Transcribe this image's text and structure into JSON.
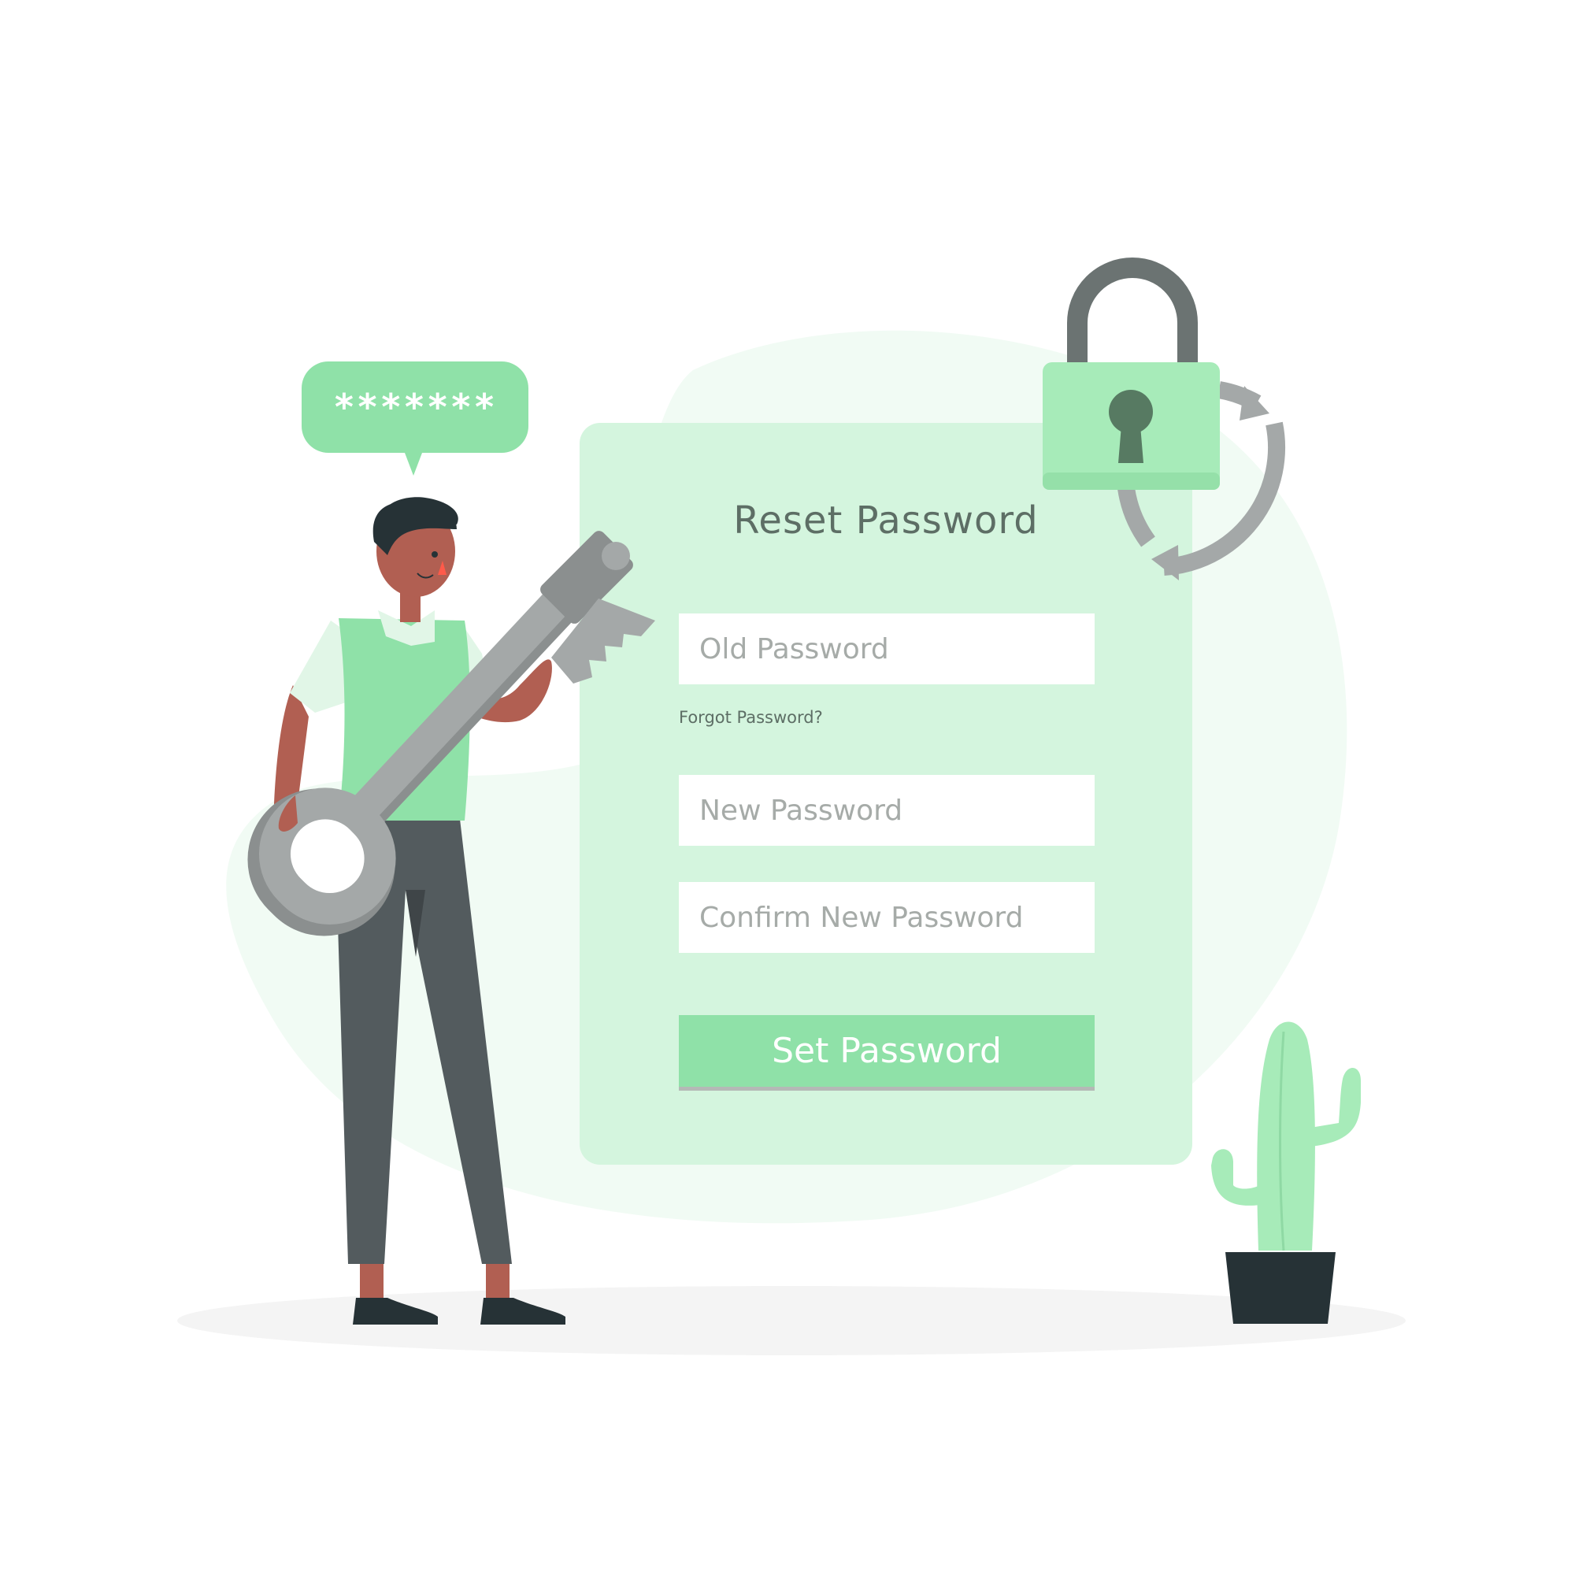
{
  "illustration": {
    "bubble_text": "*******",
    "colors": {
      "accent": "#8fe1a8",
      "card": "#d4f5de",
      "blob": "#f1fbf4",
      "lock_body": "#a7ebb9",
      "shackle": "#6b7372",
      "keyhole": "#577a62",
      "key": "#a4a8a8",
      "skin": "#b15f52",
      "pants": "#535b5e",
      "pot": "#263236",
      "cactus": "#a7ebb9"
    },
    "icons": [
      "padlock-icon",
      "refresh-arrows-icon",
      "key-icon",
      "cactus-plant"
    ]
  },
  "form": {
    "title": "Reset Password",
    "old_password_placeholder": "Old Password",
    "forgot_link": "Forgot Password?",
    "new_password_placeholder": "New Password",
    "confirm_password_placeholder": "Confirm New Password",
    "submit_label": "Set Password"
  }
}
